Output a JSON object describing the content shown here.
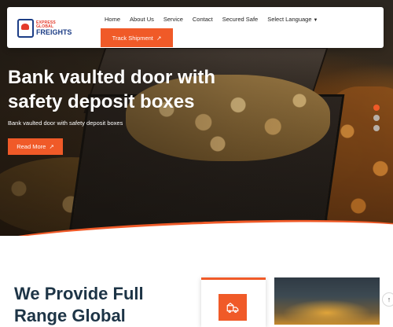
{
  "brand": {
    "logo_top": "EXPRESS GLOBAL",
    "logo_main": "FREIGHTS"
  },
  "nav": {
    "items": [
      "Home",
      "About Us",
      "Service",
      "Contact",
      "Secured Safe"
    ],
    "language_label": "Select Language",
    "language_caret": "▼",
    "track_label": "Track Shipment",
    "track_icon": "↗"
  },
  "hero": {
    "title": "Bank vaulted door with safety deposit boxes",
    "subtitle": "Bank vaulted door with safety deposit boxes",
    "cta_label": "Read More",
    "cta_icon": "↗",
    "slides_total": 3,
    "active_slide": 1
  },
  "services": {
    "heading": "We Provide Full Range Global"
  },
  "scroll_top_icon": "↑",
  "colors": {
    "accent": "#f05a28",
    "brand_blue": "#1d3e86",
    "heading_dark": "#1d3446"
  }
}
